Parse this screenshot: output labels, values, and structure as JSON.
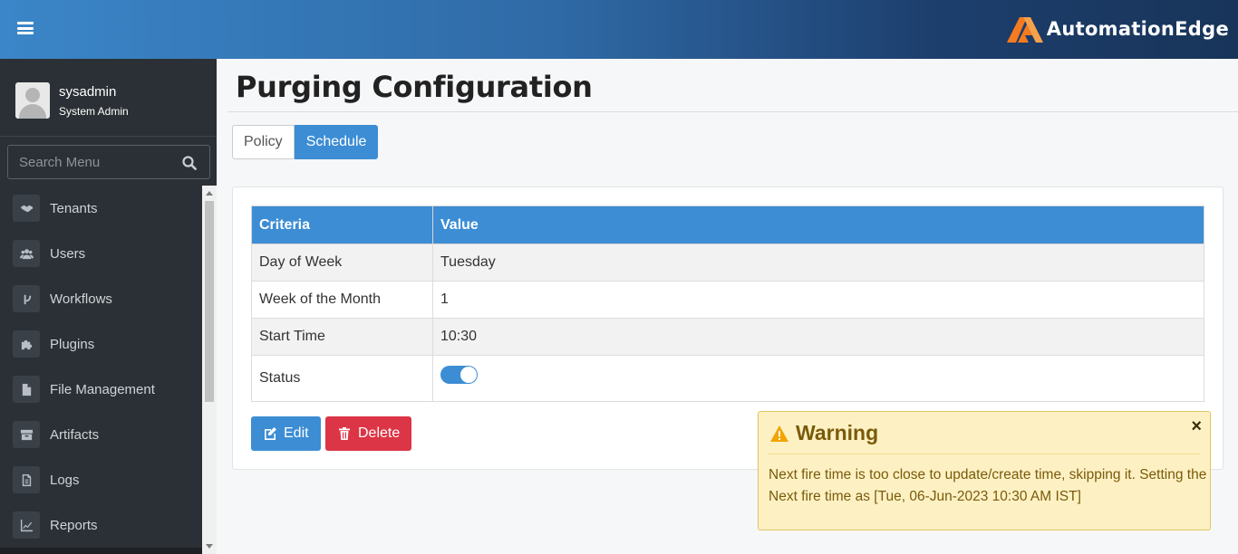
{
  "header": {
    "brand_name": "AutomationEdge"
  },
  "sidebar": {
    "user": {
      "name": "sysadmin",
      "role": "System Admin"
    },
    "search_placeholder": "Search Menu",
    "items": [
      {
        "label": "Tenants",
        "icon": "handshake-icon"
      },
      {
        "label": "Users",
        "icon": "users-icon"
      },
      {
        "label": "Workflows",
        "icon": "branch-icon"
      },
      {
        "label": "Plugins",
        "icon": "puzzle-icon"
      },
      {
        "label": "File Management",
        "icon": "file-icon"
      },
      {
        "label": "Artifacts",
        "icon": "archive-icon"
      },
      {
        "label": "Logs",
        "icon": "log-file-icon"
      },
      {
        "label": "Reports",
        "icon": "line-chart-icon"
      }
    ]
  },
  "main": {
    "title": "Purging Configuration",
    "tabs": [
      {
        "label": "Policy",
        "active": false
      },
      {
        "label": "Schedule",
        "active": true
      }
    ],
    "table": {
      "headers": [
        "Criteria",
        "Value"
      ],
      "rows": [
        {
          "criteria": "Day of Week",
          "value": "Tuesday"
        },
        {
          "criteria": "Week of the Month",
          "value": "1"
        },
        {
          "criteria": "Start Time",
          "value": "10:30"
        },
        {
          "criteria": "Status",
          "value": ""
        }
      ],
      "status_enabled": true
    },
    "buttons": {
      "edit": "Edit",
      "delete": "Delete"
    }
  },
  "toast": {
    "title": "Warning",
    "close": "×",
    "message": "Next fire time is too close to update/create time, skipping it. Setting the Next fire time as [Tue, 06-Jun-2023 10:30 AM IST]"
  },
  "colors": {
    "accent": "#3c8dd4",
    "danger": "#dc3545",
    "sidebar_bg": "#2b3036",
    "warning_bg": "#fdf1c4",
    "brand_orange": "#f47b20"
  }
}
